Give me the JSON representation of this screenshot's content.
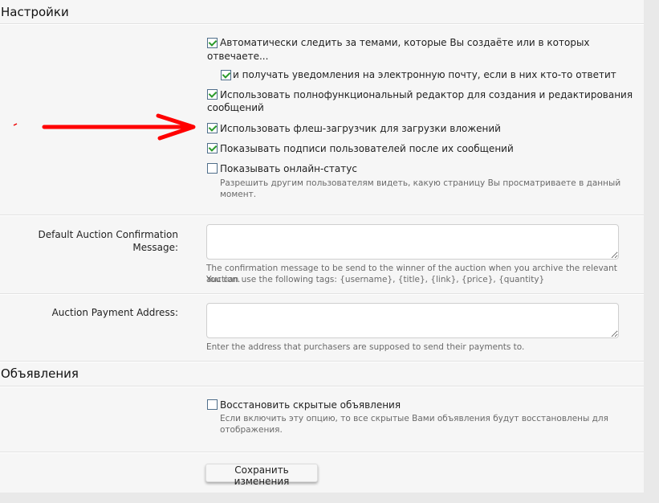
{
  "settings": {
    "title": "Настройки",
    "options": [
      {
        "label": "Автоматически следить за темами, которые Вы создаёте или в которых",
        "label2": "отвечаете...",
        "checked": true
      },
      {
        "label": "и получать уведомления на электронную почту, если в них кто-то ответит",
        "checked": true
      },
      {
        "label": "Использовать полнофункциональный редактор для создания и редактирования",
        "label2": "сообщений",
        "checked": true
      },
      {
        "label": "Использовать флеш-загрузчик для загрузки вложений",
        "checked": true
      },
      {
        "label": "Показывать подписи пользователей после их сообщений",
        "checked": true
      },
      {
        "label": "Показывать онлайн-статус",
        "checked": false,
        "hint": "Разрешить другим пользователям видеть, какую страницу Вы просматриваете в данный",
        "hint2": "момент."
      }
    ],
    "auction_confirm": {
      "label": "Default Auction Confirmation",
      "label2": "Message:",
      "value": "",
      "hint": "The confirmation message to be send to the winner of the auction when you archive the relevant auction.",
      "hint2": "You can use the following tags: {username}, {title}, {link}, {price}, {quantity}"
    },
    "auction_address": {
      "label": "Auction Payment Address:",
      "value": "",
      "hint": "Enter the address that purchasers are supposed to send their payments to."
    }
  },
  "ads": {
    "title": "Объявления",
    "restore": {
      "label": "Восстановить скрытые объявления",
      "checked": false,
      "hint": "Если включить эту опцию, то все скрытые Вами объявления будут восстановлены для",
      "hint2": "отображения."
    }
  },
  "save_label": "Сохранить изменения",
  "annotation_color": "#ff0000"
}
